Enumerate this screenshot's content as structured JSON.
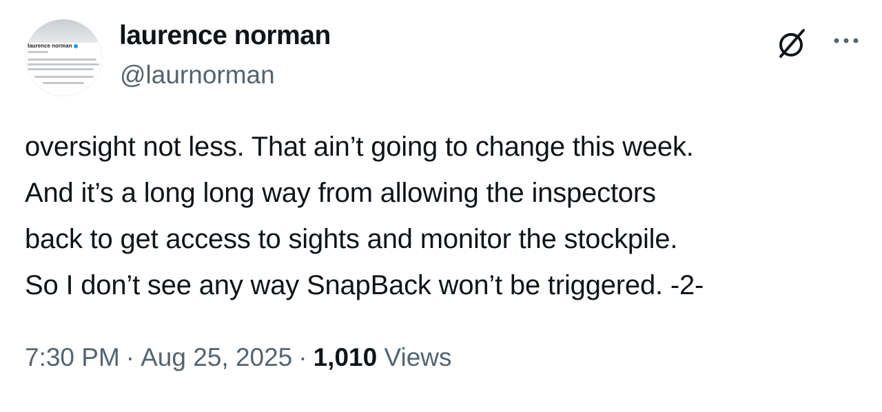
{
  "author": {
    "display_name": "laurence norman",
    "handle": "@laurnorman",
    "avatar_name": "laurence norman"
  },
  "icons": {
    "grok": "grok-slash-circle-icon",
    "more": "more-horizontal-icon"
  },
  "tweet": {
    "lines": [
      "oversight not less. That ain’t going to change this week.",
      "And it’s a long long way from allowing the inspectors",
      "back to get access to sights and monitor the stockpile.",
      "So I don’t see any way SnapBack won’t be triggered. -2-"
    ]
  },
  "meta": {
    "time": "7:30 PM",
    "separator": "·",
    "date": "Aug 25, 2025",
    "views_count": "1,010",
    "views_label": "Views"
  },
  "colors": {
    "text_primary": "#0f1419",
    "text_secondary": "#536471",
    "verified": "#1d9bf0"
  }
}
